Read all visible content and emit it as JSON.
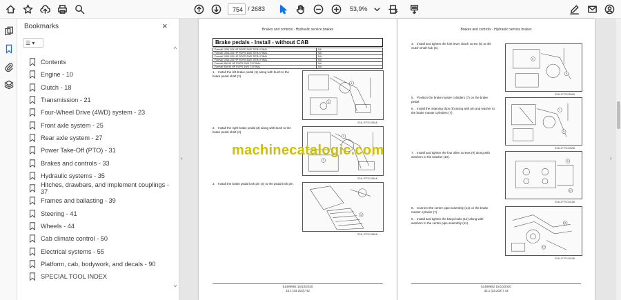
{
  "toolbar": {
    "current_page": "754",
    "page_total": "/ 2683",
    "zoom": "53,9%"
  },
  "panel": {
    "title": "Bookmarks",
    "close_glyph": "×",
    "options_glyph": "☰ ▾"
  },
  "bookmarks": [
    "Contents",
    "Engine - 10",
    "Clutch - 18",
    "Transmission - 21",
    "Four-Wheel Drive (4WD) system - 23",
    "Front axle system - 25",
    "Rear axle system - 27",
    "Power Take-Off (PTO) - 31",
    "Brakes and controls - 33",
    "Hydraulic systems - 35",
    "Hitches, drawbars, and implement couplings - 37",
    "Frames and ballasting - 39",
    "Steering - 41",
    "Wheels - 44",
    "Cab climate control - 50",
    "Electrical systems - 55",
    "Platform, cab, bodywork, and decals - 90",
    "SPECIAL TOOL INDEX"
  ],
  "left_page": {
    "header": "Brakes and controls - Hydraulic service brakes",
    "title": "Brake pedals - Install - without CAB",
    "table": [
      [
        "Farmall 105A 105 HP ROPS 2WD TIER4 FINAL",
        "NA"
      ],
      [
        "Farmall 105A 105 HP ROPS 4WD TIER4 FINAL",
        "NA"
      ],
      [
        "Farmall 105A 105 HP ROPS 2WD TIER4 FINAL",
        "NA"
      ],
      [
        "Farmall 105A 105 HP ROPS 4WD TIER4 FINAL",
        "NA"
      ],
      [
        "Farmall 95A 95 HP ROPS 2WD T4 FINAL",
        "NA"
      ],
      [
        "Farmall 95A 95 HP ROPS 4WD T4 FINAL",
        "NA"
      ]
    ],
    "steps": [
      {
        "num": "1.",
        "text": "Install the left brake pedal (1) along with bush to the brake pedal shaft (2)."
      },
      {
        "num": "2.",
        "text": "Install the right brake pedal (3) along with bush to the brake pedal shaft (2)."
      },
      {
        "num": "3.",
        "text": "Install the brake pedal lock pin (4) to the pedal lock pin."
      }
    ],
    "captions": [
      "SS4L1PTR1285AB",
      "SS4L1PTR1286AB",
      "SS4L1PTR1288AB"
    ],
    "footer_code": "51499992 15/10/2020",
    "footer_page": "33.1 [33.202] / 42"
  },
  "right_page": {
    "header": "Brakes and controls - Hydraulic service brakes",
    "steps": [
      {
        "num": "4.",
        "text": "Install and tighten the fork lever clutch screw (5) to the clutch shaft hub (6)."
      },
      {
        "num": "5.",
        "text": "Position the brake master cylinders (7) on the brake pedal."
      },
      {
        "num": "6.",
        "text": "Install the retaining clips (8) along with pin and washer to the brake master cylinders (7)."
      },
      {
        "num": "7.",
        "text": "Install and tighten the four allen screws (9) along with washers to the bracket (10)."
      },
      {
        "num": "8.",
        "text": "Connect the centre pipe assembly (11) on the brake master cylinder (7)."
      },
      {
        "num": "9.",
        "text": "Install and tighten the banjo bolts (12) along with washers to the centre pipe assembly (11)."
      }
    ],
    "captions": [
      "SS4L1PTR1289AB",
      "SS4L1PTR1290AB",
      "SS4L1PTR1291AB",
      "SS4L1PTR1292AB"
    ],
    "footer_code": "51499992 15/10/2020",
    "footer_page": "33.1 [33.202] / 43"
  },
  "watermark": "machinecatalogic.com",
  "colors": {
    "accent": "#1473e6",
    "watermark": "#cfc000",
    "viewer_bg": "#e6e6e6"
  }
}
